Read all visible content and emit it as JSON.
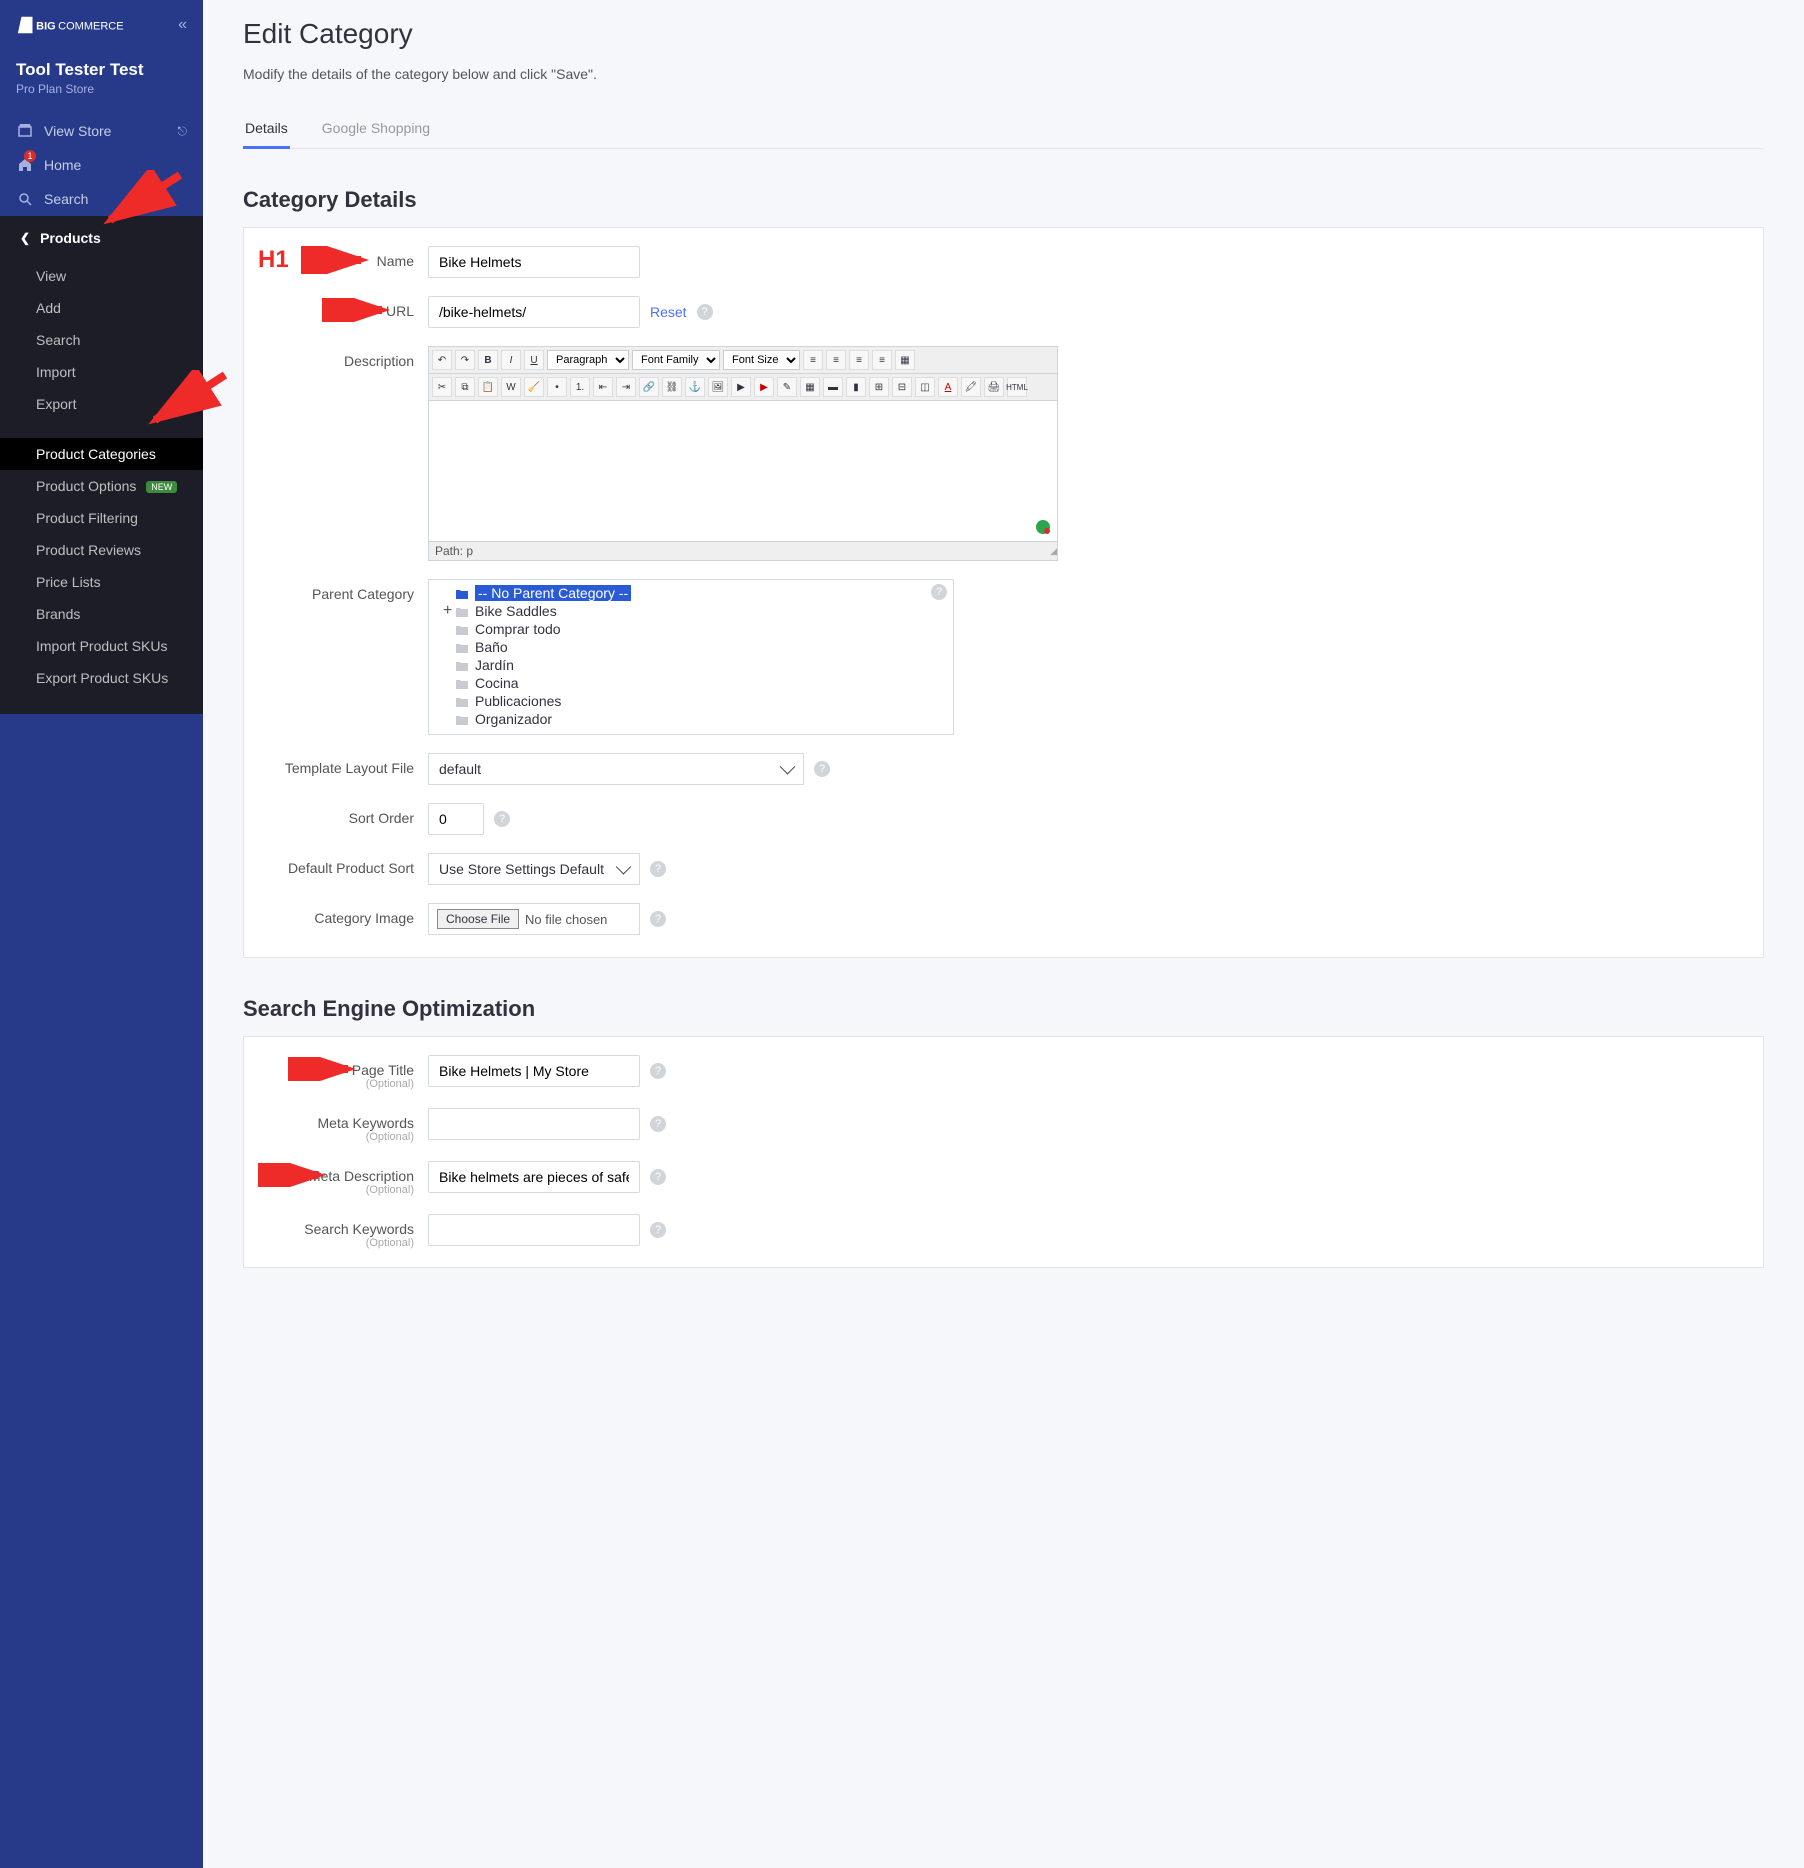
{
  "brand": "BIGCOMMERCE",
  "store": {
    "name": "Tool Tester Test",
    "plan": "Pro Plan Store"
  },
  "nav": {
    "view_store": "View Store",
    "home": "Home",
    "home_badge": "1",
    "search": "Search"
  },
  "products_header": "Products",
  "sub": {
    "view": "View",
    "add": "Add",
    "search": "Search",
    "import": "Import",
    "export": "Export",
    "categories": "Product Categories",
    "options": "Product Options",
    "options_new": "NEW",
    "filtering": "Product Filtering",
    "reviews": "Product Reviews",
    "price_lists": "Price Lists",
    "brands": "Brands",
    "import_skus": "Import Product SKUs",
    "export_skus": "Export Product SKUs"
  },
  "page": {
    "title": "Edit Category",
    "desc": "Modify the details of the category below and click \"Save\"."
  },
  "tabs": {
    "details": "Details",
    "google": "Google Shopping"
  },
  "section_details": "Category Details",
  "section_seo": "Search Engine Optimization",
  "annotation_h1": "H1",
  "labels": {
    "name": "Name",
    "url": "URL",
    "description": "Description",
    "parent": "Parent Category",
    "template": "Template Layout File",
    "sort": "Sort Order",
    "default_sort": "Default Product Sort",
    "image": "Category Image",
    "page_title": "Page Title",
    "meta_keywords": "Meta Keywords",
    "meta_desc": "Meta Description",
    "search_keywords": "Search Keywords",
    "optional": "(Optional)"
  },
  "fields": {
    "name": "Bike Helmets",
    "url": "/bike-helmets/",
    "reset": "Reset",
    "template": "default",
    "sort": "0",
    "default_sort": "Use Store Settings Default",
    "choose_file": "Choose File",
    "no_file": "No file chosen",
    "page_title": "Bike Helmets | My Store",
    "meta_keywords": "",
    "meta_desc": "Bike helmets are pieces of safety equipm",
    "search_keywords": ""
  },
  "editor": {
    "paragraph": "Paragraph",
    "font_family": "Font Family",
    "font_size": "Font Size",
    "path": "Path: p"
  },
  "parent_tree": [
    {
      "label": "-- No Parent Category --",
      "selected": true,
      "color": "blue"
    },
    {
      "label": "Bike Saddles",
      "expander": "+",
      "color": "grey"
    },
    {
      "label": "Comprar todo",
      "color": "grey"
    },
    {
      "label": "Baño",
      "color": "grey"
    },
    {
      "label": "Jardín",
      "color": "grey"
    },
    {
      "label": "Cocina",
      "color": "grey"
    },
    {
      "label": "Publicaciones",
      "color": "grey"
    },
    {
      "label": "Organizador",
      "color": "grey"
    }
  ]
}
